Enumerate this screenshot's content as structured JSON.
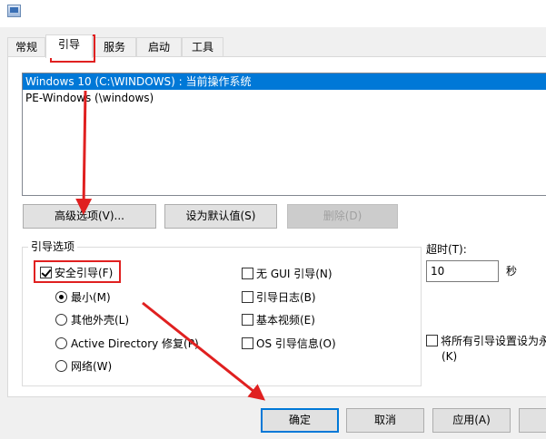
{
  "tabs": [
    "常规",
    "引导",
    "服务",
    "启动",
    "工具"
  ],
  "os_entries": [
    "Windows 10 (C:\\WINDOWS) : 当前操作系统",
    "PE-Windows (\\windows)"
  ],
  "buttons": {
    "advanced": "高级选项(V)...",
    "set_default": "设为默认值(S)",
    "delete": "删除(D)"
  },
  "boot_options": {
    "title": "引导选项",
    "safe_boot": "安全引导(F)",
    "minimal": "最小(M)",
    "alternate_shell": "其他外壳(L)",
    "ad_repair": "Active Directory 修复(P)",
    "network": "网络(W)",
    "no_gui": "无 GUI 引导(N)",
    "boot_log": "引导日志(B)",
    "base_video": "基本视频(E)",
    "os_boot_info": "OS 引导信息(O)"
  },
  "timeout": {
    "label": "超时(T):",
    "value": "10",
    "unit": "秒"
  },
  "make_permanent": {
    "line1": "将所有引导设置设为永",
    "line2": "(K)"
  },
  "footer": {
    "ok": "确定",
    "cancel": "取消",
    "apply": "应用(A)"
  },
  "colors": {
    "selection": "#0078d7",
    "annotation": "#e02020"
  }
}
